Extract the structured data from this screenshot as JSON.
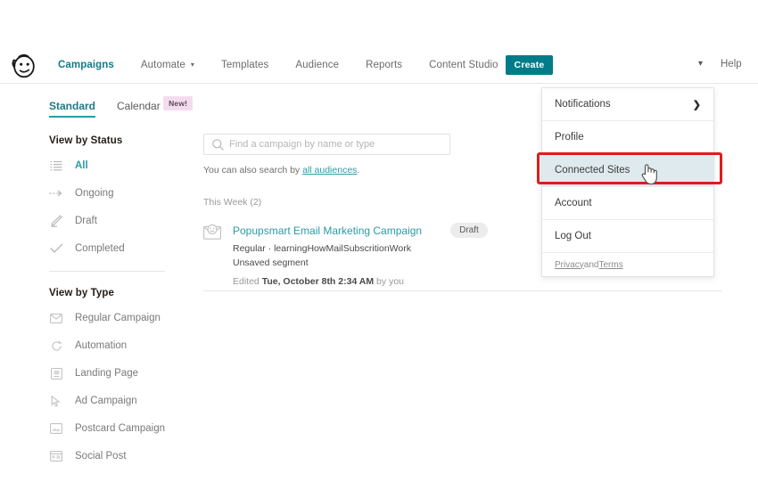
{
  "header": {
    "logo_name": "mailchimp-freddie-logo",
    "nav": [
      {
        "label": "Campaigns",
        "active": true,
        "caret": false
      },
      {
        "label": "Automate",
        "active": false,
        "caret": true
      },
      {
        "label": "Templates",
        "active": false,
        "caret": false
      },
      {
        "label": "Audience",
        "active": false,
        "caret": false
      },
      {
        "label": "Reports",
        "active": false,
        "caret": false
      },
      {
        "label": "Content Studio",
        "active": false,
        "caret": false
      }
    ],
    "create_label": "Create",
    "help_label": "Help",
    "account_caret": "▾",
    "accent_teal": "#007C89"
  },
  "subtabs": [
    {
      "label": "Standard",
      "active": true
    },
    {
      "label": "Calendar",
      "active": false
    }
  ],
  "calendar_badge": "New!",
  "sidebar": {
    "status_heading": "View by Status",
    "status_items": [
      {
        "label": "All",
        "icon": "list-icon",
        "active": true
      },
      {
        "label": "Ongoing",
        "icon": "arrow-right-dashed-icon",
        "active": false
      },
      {
        "label": "Draft",
        "icon": "pencil-icon",
        "active": false
      },
      {
        "label": "Completed",
        "icon": "check-icon",
        "active": false
      }
    ],
    "type_heading": "View by Type",
    "type_items": [
      {
        "label": "Regular Campaign",
        "icon": "envelope-icon"
      },
      {
        "label": "Automation",
        "icon": "refresh-circle-icon"
      },
      {
        "label": "Landing Page",
        "icon": "landing-page-icon"
      },
      {
        "label": "Ad Campaign",
        "icon": "cursor-arrow-icon"
      },
      {
        "label": "Postcard Campaign",
        "icon": "postcard-icon"
      },
      {
        "label": "Social Post",
        "icon": "social-post-icon"
      }
    ]
  },
  "main": {
    "search_placeholder": "Find a campaign by name or type",
    "search_value": "",
    "search_hint_prefix": "You can also search by ",
    "search_hint_link": "all audiences",
    "search_hint_suffix": ".",
    "week_label": "This Week (2)",
    "campaign": {
      "title": "Popupsmart Email Marketing Campaign",
      "status": "Draft",
      "meta": "Regular · learningHowMailSubscritionWork",
      "segment": "Unsaved segment",
      "edited_prefix": "Edited ",
      "edited_date": "Tue, October 8th 2:34 AM",
      "edited_suffix": " by you"
    }
  },
  "dropdown": {
    "items": [
      {
        "label": "Notifications",
        "chevron": "❯",
        "highlight": false
      },
      {
        "label": "Profile",
        "chevron": "",
        "highlight": false
      },
      {
        "label": "Connected Sites",
        "chevron": "",
        "highlight": true
      },
      {
        "label": "Account",
        "chevron": "",
        "highlight": false
      },
      {
        "label": "Log Out",
        "chevron": "",
        "highlight": false
      }
    ],
    "footer_privacy": "Privacy",
    "footer_and": " and ",
    "footer_terms": "Terms",
    "highlight_color": "#DFEAEE",
    "annotation_color": "#E01B1B"
  }
}
